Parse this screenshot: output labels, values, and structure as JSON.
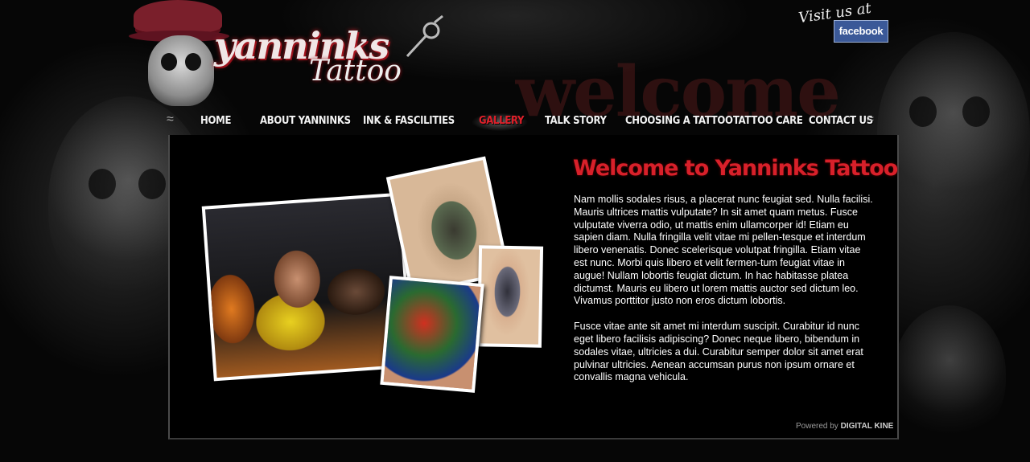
{
  "brand": {
    "logo_name": "yanninks",
    "logo_sub": "Tattoo",
    "logo_alt": "Yanninks Tattoo logo"
  },
  "header": {
    "facebook_prefix": "Visit us at",
    "facebook_label": "facebook",
    "background_word": "welcome"
  },
  "nav": {
    "items": [
      {
        "label": "Home",
        "active": false
      },
      {
        "label": "About Yanninks",
        "active": false
      },
      {
        "label": "Ink & Fascilities",
        "active": false
      },
      {
        "label": "Gallery",
        "active": true
      },
      {
        "label": "Talk Story",
        "active": false
      },
      {
        "label": "Choosing a Tattoo",
        "active": false
      },
      {
        "label": "Tattoo Care",
        "active": false
      },
      {
        "label": "Contact Us",
        "active": false
      }
    ]
  },
  "main": {
    "heading": "Welcome to Yanninks Tattoo",
    "paragraphs": [
      "Nam mollis sodales risus, a placerat nunc feugiat sed. Nulla facilisi. Mauris ultrices mattis vulputate? In sit amet quam metus. Fusce vulputate viverra odio, ut mattis enim ullamcorper id! Etiam eu sapien diam. Nulla fringilla velit vitae mi pellen-tesque et interdum libero venenatis. Donec scelerisque volutpat fringilla. Etiam vitae est nunc. Morbi quis libero et velit fermen-tum feugiat vitae in augue! Nullam lobortis feugiat dictum. In hac habitasse platea dictumst. Mauris eu libero ut lorem mattis auctor sed dictum leo. Vivamus porttitor justo non eros dictum lobortis.",
      "Fusce vitae ante sit amet mi interdum suscipit. Curabitur id nunc eget libero facilisis adipiscing? Donec neque libero, bibendum in sodales vitae, ultricies a dui. Curabitur semper dolor sit amet erat pulvinar ultricies. Aenean accumsan purus non ipsum ornare et convallis magna vehicula."
    ]
  },
  "footer": {
    "powered_prefix": "Powered by",
    "powered_name": "DIGITAL KINE"
  },
  "colors": {
    "accent_red": "#d8202a",
    "facebook_blue": "#3b5998",
    "background": "#050505"
  }
}
